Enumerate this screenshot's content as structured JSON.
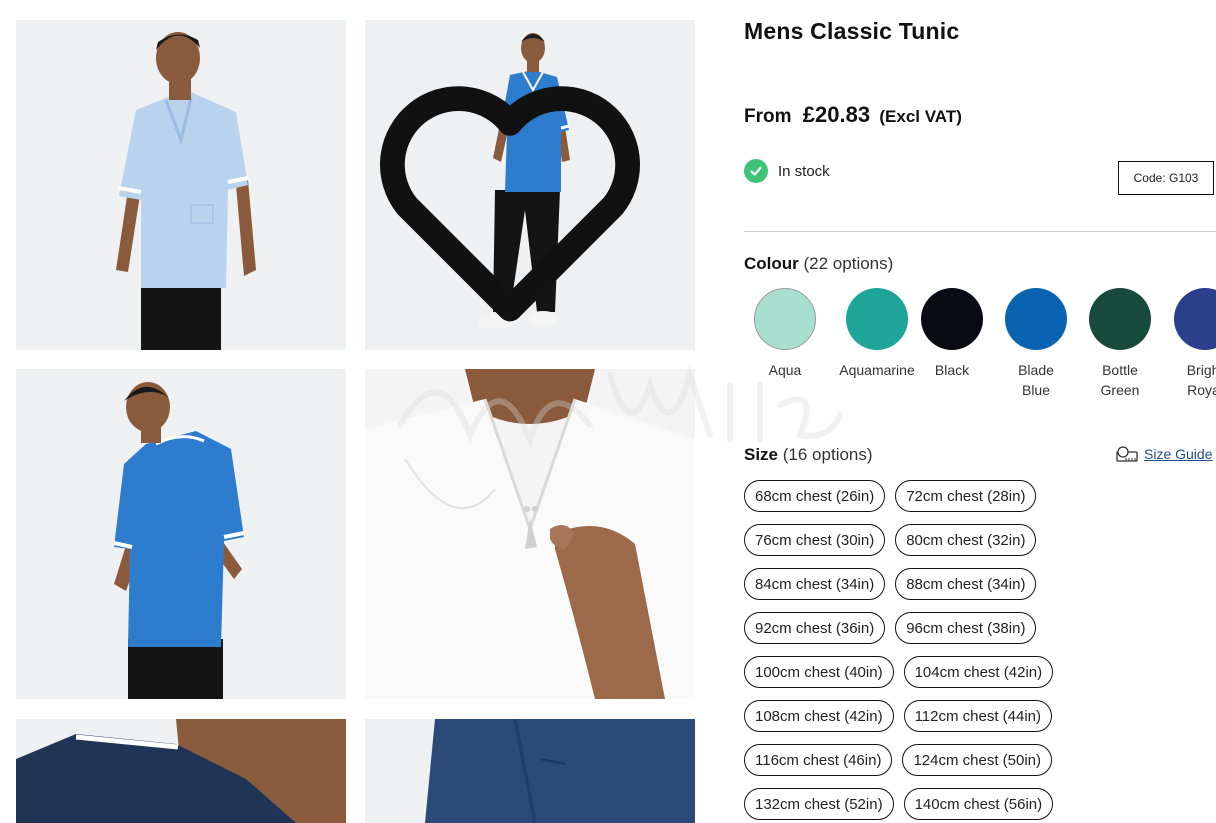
{
  "product": {
    "title": "Mens Classic Tunic",
    "price_prefix": "From",
    "price": "£20.83",
    "price_suffix": "(Excl VAT)",
    "stock_status": "In stock",
    "code": "Code: G103"
  },
  "colour": {
    "heading": "Colour",
    "count": "(22 options)",
    "options": [
      {
        "name": "Aqua",
        "hex": "#a8e0cf"
      },
      {
        "name": "Aquamarine",
        "hex": "#1fa597"
      },
      {
        "name": "Black",
        "hex": "#0a0b12"
      },
      {
        "name": "Blade Blue",
        "hex": "#0a63b0"
      },
      {
        "name": "Bottle Green",
        "hex": "#174a3a"
      },
      {
        "name": "Bright Royal",
        "hex": "#2b3f8c"
      }
    ]
  },
  "size": {
    "heading": "Size",
    "count": "(16 options)",
    "guide_label": "Size Guide",
    "options": [
      "68cm chest (26in)",
      "72cm chest (28in)",
      "76cm chest (30in)",
      "80cm chest (32in)",
      "84cm chest (34in)",
      "88cm chest (34in)",
      "92cm chest (36in)",
      "96cm chest (38in)",
      "100cm chest (40in)",
      "104cm chest (42in)",
      "108cm chest (42in)",
      "112cm chest (44in)",
      "116cm chest (46in)",
      "124cm chest (50in)",
      "132cm chest (52in)",
      "140cm chest (56in)"
    ]
  },
  "gallery": {
    "images": [
      "light-blue-tunic-front",
      "mid-blue-tunic-full-length",
      "mid-blue-tunic-back",
      "white-tunic-neck-detail",
      "navy-tunic-collar-detail",
      "navy-tunic-pocket-detail"
    ],
    "wishlist_icon": "heart-icon"
  },
  "colors": {
    "accent_link": "#1f4f8a",
    "stock_green": "#3fc27a",
    "text": "#111111"
  }
}
